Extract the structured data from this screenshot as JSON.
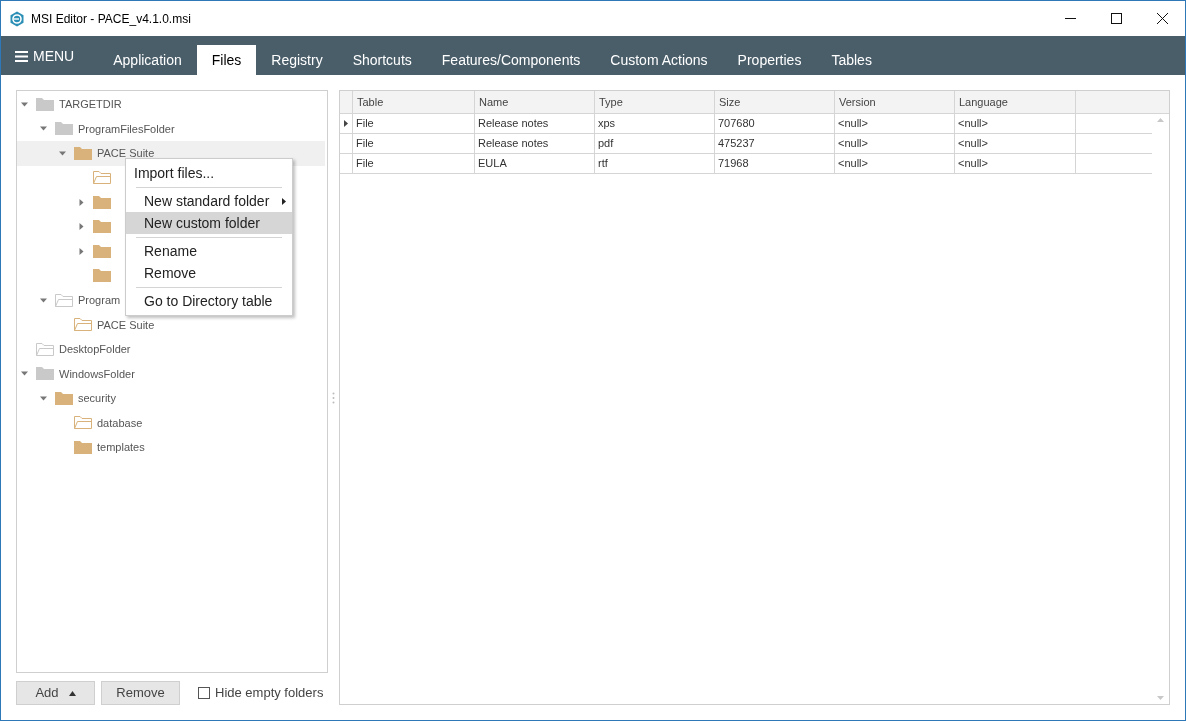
{
  "window": {
    "title": "MSI Editor - PACE_v4.1.0.msi"
  },
  "menu_button": {
    "label": "MENU"
  },
  "tabs": [
    {
      "label": "Application",
      "selected": false
    },
    {
      "label": "Files",
      "selected": true
    },
    {
      "label": "Registry",
      "selected": false
    },
    {
      "label": "Shortcuts",
      "selected": false
    },
    {
      "label": "Features/Components",
      "selected": false
    },
    {
      "label": "Custom Actions",
      "selected": false
    },
    {
      "label": "Properties",
      "selected": false
    },
    {
      "label": "Tables",
      "selected": false
    }
  ],
  "tree": [
    {
      "label": "TARGETDIR",
      "kind": "gray-filled",
      "expanded": true,
      "selected": false,
      "children": [
        {
          "label": "ProgramFilesFolder",
          "kind": "gray-filled",
          "expanded": true,
          "selected": false,
          "children": [
            {
              "label": "PACE Suite",
              "kind": "tan-filled",
              "expanded": true,
              "selected": true,
              "children": [
                {
                  "kind": "tan-outline",
                  "selected": false
                },
                {
                  "kind": "tan-filled",
                  "expanded": false,
                  "selected": false
                },
                {
                  "kind": "tan-filled",
                  "expanded": false,
                  "selected": false
                },
                {
                  "kind": "tan-filled",
                  "expanded": false,
                  "selected": false
                },
                {
                  "kind": "tan-filled",
                  "selected": false
                }
              ]
            }
          ]
        },
        {
          "label": "Program",
          "kind": "gray-outline",
          "expanded": true,
          "selected": false,
          "children": [
            {
              "label": "PACE Suite",
              "kind": "tan-outline",
              "selected": false
            }
          ]
        }
      ]
    },
    {
      "label": "DesktopFolder",
      "kind": "gray-outline",
      "selected": false
    },
    {
      "label": "WindowsFolder",
      "kind": "gray-filled",
      "expanded": true,
      "selected": false,
      "children": [
        {
          "label": "security",
          "kind": "tan-filled",
          "expanded": true,
          "selected": false,
          "children": [
            {
              "label": "database",
              "kind": "tan-outline",
              "selected": false
            },
            {
              "label": "templates",
              "kind": "tan-filled",
              "selected": false
            }
          ]
        }
      ]
    }
  ],
  "context_menu": {
    "groups": [
      [
        {
          "label": "Import files...",
          "submenu": false,
          "selected": false
        }
      ],
      [
        {
          "label": "New standard folder",
          "submenu": true,
          "selected": false
        },
        {
          "label": "New custom folder",
          "submenu": false,
          "selected": true
        }
      ],
      [
        {
          "label": "Rename",
          "submenu": false,
          "selected": false
        },
        {
          "label": "Remove",
          "submenu": false,
          "selected": false
        }
      ],
      [
        {
          "label": "Go to Directory table",
          "submenu": false,
          "selected": false
        }
      ]
    ]
  },
  "buttons": {
    "add": "Add",
    "remove": "Remove"
  },
  "hide_empty_folders": {
    "label": "Hide empty folders",
    "checked": false
  },
  "table": {
    "columns": [
      "Table",
      "Name",
      "Type",
      "Size",
      "Version",
      "Language"
    ],
    "rows": [
      {
        "current": true,
        "cells": [
          "File",
          "Release notes",
          "xps",
          "707680",
          "<null>",
          "<null>"
        ]
      },
      {
        "current": false,
        "cells": [
          "File",
          "Release notes",
          "pdf",
          "475237",
          "<null>",
          "<null>"
        ]
      },
      {
        "current": false,
        "cells": [
          "File",
          "EULA",
          "rtf",
          "71968",
          "<null>",
          "<null>"
        ]
      }
    ]
  }
}
